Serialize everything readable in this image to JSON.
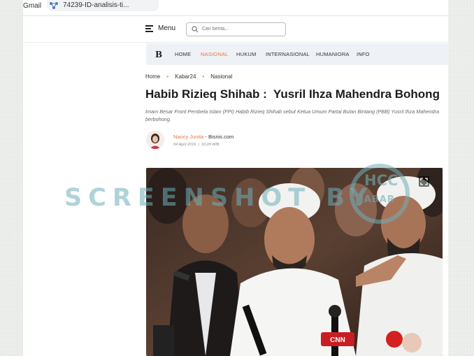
{
  "bookmarks": {
    "gmail_label": "Gmail",
    "tab_label": "74239-ID-analisis-ti..."
  },
  "header": {
    "menu_label": "Menu",
    "search_placeholder": "Cari berita..."
  },
  "nav": {
    "items": [
      "HOME",
      "NASIONAL",
      "HUKUM",
      "INTERNASIONAL",
      "HUMANIORA",
      "INFO"
    ],
    "active": "NASIONAL",
    "logo_glyph": "B"
  },
  "breadcrumb": [
    "Home",
    "Kabar24",
    "Nasional"
  ],
  "article": {
    "title": "Habib Rizieq Shihab :  Yusril Ihza Mahendra Bohong",
    "subtitle": "Imam Besar Front Pembela Islam (FPI) Habib Rizieq Shihab sebut Ketua Umum Partai Bulan Bintang (PBB) Yusril Ihza Mahendra berbohong.",
    "author": "Nancy Junita",
    "source": " - Bisnis.com",
    "date": "04 April 2019",
    "time": "10:28 WIB"
  },
  "photo": {
    "badges": [
      "CNN Indonesia"
    ]
  },
  "watermark": {
    "text": "SCREENSHOT BY",
    "logo_line1": "HCC",
    "logo_line2": "JABAR"
  },
  "colors": {
    "accent": "#e47a48",
    "nav_bg": "#eef1f6",
    "watermark": "#6eafb9"
  }
}
